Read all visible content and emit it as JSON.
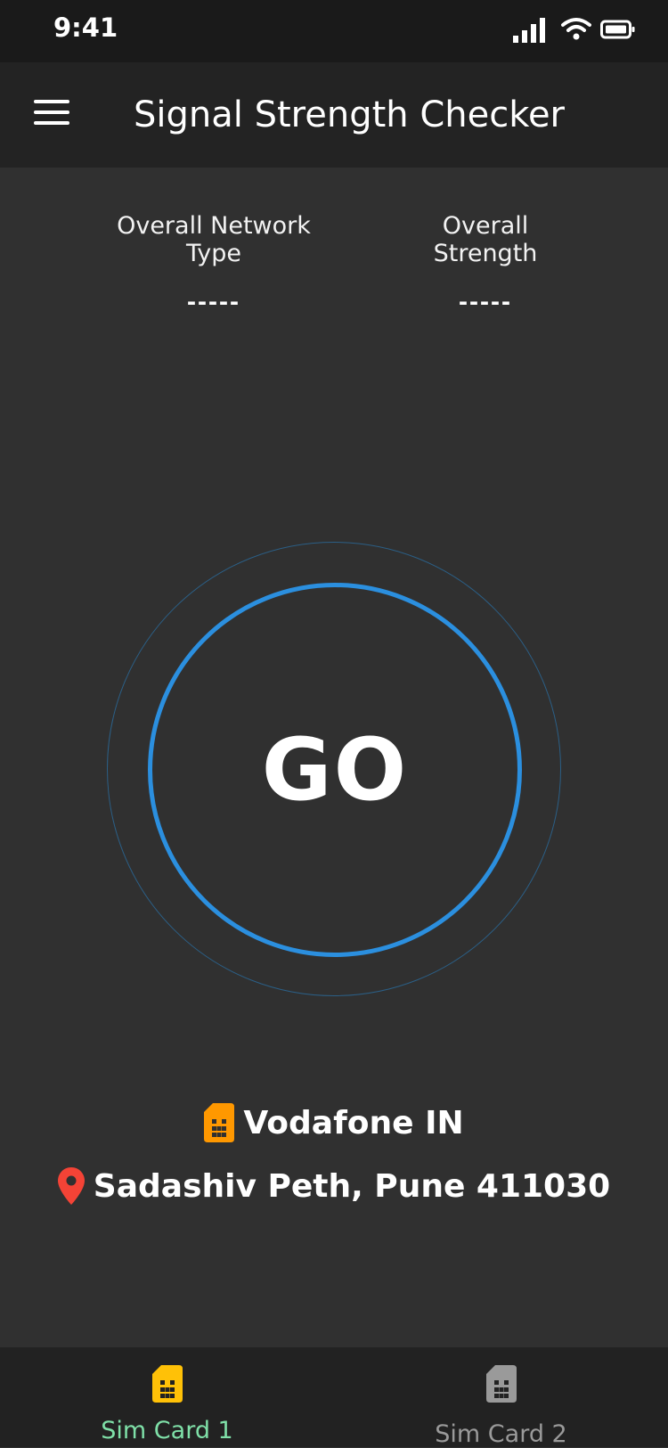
{
  "status_bar": {
    "time": "9:41"
  },
  "app_bar": {
    "title": "Signal Strength Checker"
  },
  "metrics": {
    "network_type": {
      "label": "Overall Network Type",
      "value": "-----"
    },
    "strength": {
      "label": "Overall Strength",
      "value": "-----"
    }
  },
  "go_button": {
    "label": "GO"
  },
  "carrier": {
    "name": "Vodafone IN",
    "icon": "sim-card-icon"
  },
  "location": {
    "text": "Sadashiv Peth, Pune 411030",
    "icon": "location-pin-icon"
  },
  "bottom_nav": {
    "items": [
      {
        "label": "Sim Card 1",
        "icon": "sim-card-icon",
        "active": true
      },
      {
        "label": "Sim Card 2",
        "icon": "sim-card-icon",
        "active": false
      }
    ]
  },
  "colors": {
    "accent_ring": "#2b8fdf",
    "outer_ring": "#2b5f86",
    "sim_orange": "#ff9800",
    "sim_yellow": "#ffc107",
    "pin_red": "#f44336",
    "active_tab": "#7fe0a8",
    "inactive_tab": "#9a9a9a"
  }
}
